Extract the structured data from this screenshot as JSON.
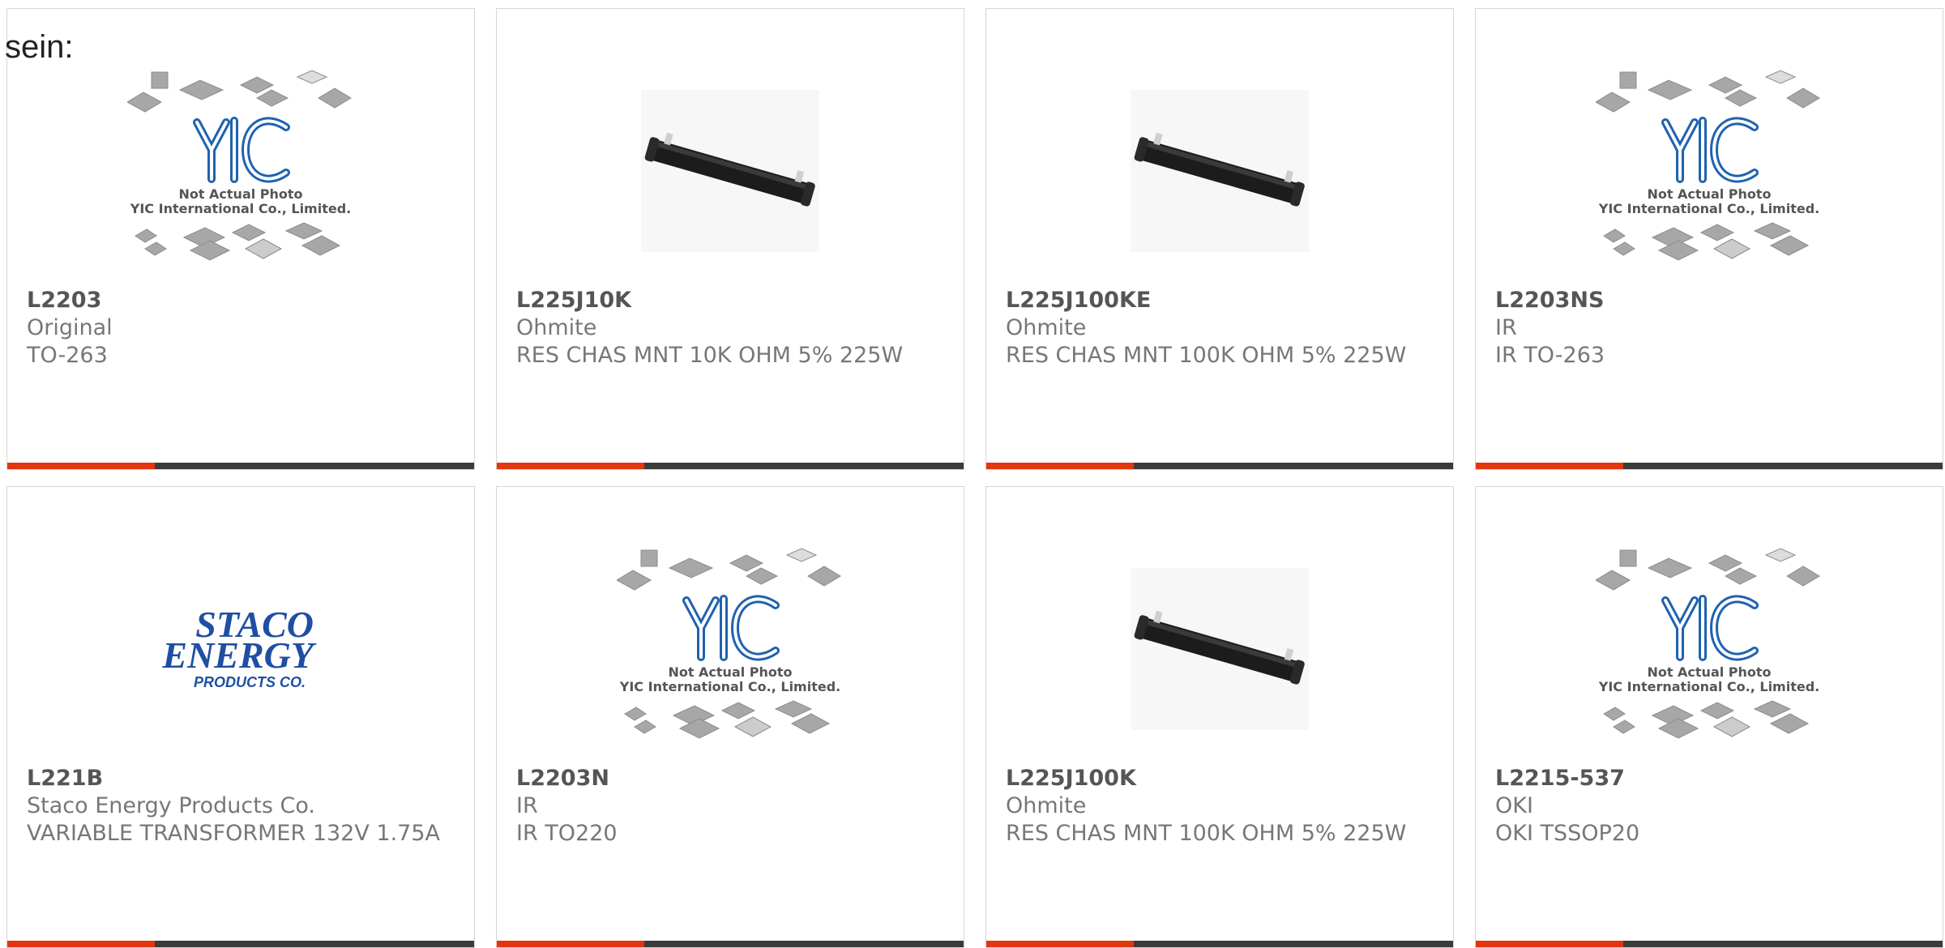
{
  "intro_text": "sein:",
  "colors": {
    "accent": "#e2360e",
    "bar": "#3b3b3b",
    "yic_blue": "#1f62b0",
    "staco_blue": "#1f4fa2"
  },
  "yic": {
    "logo": "YIC",
    "caption1": "Not Actual Photo",
    "caption2": "YIC International Co., Limited."
  },
  "staco": {
    "line1": "STACO",
    "line2": "ENERGY",
    "line3": "PRODUCTS CO."
  },
  "products": [
    {
      "part": "L2203",
      "brand": "Original",
      "desc": "TO-263",
      "image": "yic-placeholder"
    },
    {
      "part": "L225J10K",
      "brand": "Ohmite",
      "desc": "RES CHAS MNT 10K OHM 5% 225W",
      "image": "resistor"
    },
    {
      "part": "L225J100KE",
      "brand": "Ohmite",
      "desc": "RES CHAS MNT 100K OHM 5% 225W",
      "image": "resistor"
    },
    {
      "part": "L2203NS",
      "brand": "IR",
      "desc": "IR TO-263",
      "image": "yic-placeholder"
    },
    {
      "part": "L221B",
      "brand": "Staco Energy Products Co.",
      "desc": "VARIABLE TRANSFORMER 132V 1.75A",
      "image": "staco-logo"
    },
    {
      "part": "L2203N",
      "brand": "IR",
      "desc": "IR TO220",
      "image": "yic-placeholder"
    },
    {
      "part": "L225J100K",
      "brand": "Ohmite",
      "desc": "RES CHAS MNT 100K OHM 5% 225W",
      "image": "resistor"
    },
    {
      "part": "L2215-537",
      "brand": "OKI",
      "desc": "OKI TSSOP20",
      "image": "yic-placeholder"
    }
  ]
}
